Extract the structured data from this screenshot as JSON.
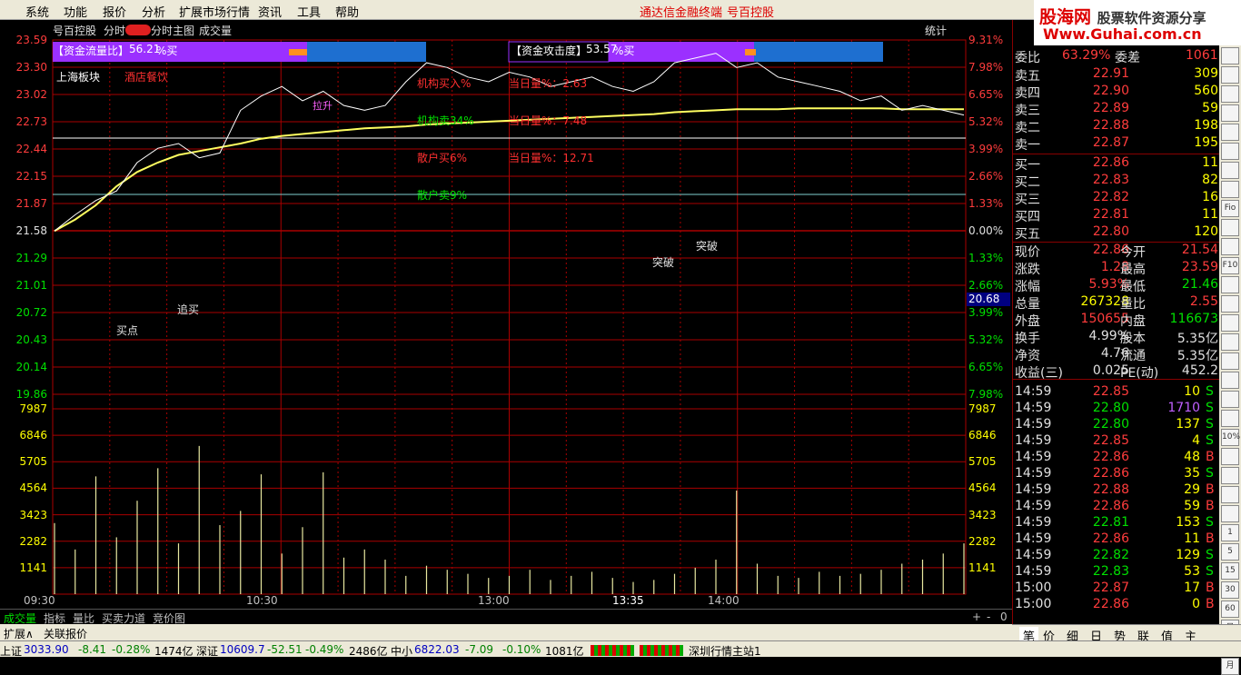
{
  "menu": [
    "系统",
    "功能",
    "报价",
    "分析",
    "扩展市场行情",
    "资讯",
    "工具",
    "帮助"
  ],
  "app_title": "通达信金融终端",
  "stock_name": "号百控股",
  "logo": {
    "line1a": "股海网",
    "line1b": "股票软件资源分享",
    "line2": "Www.Guhai.com.cn"
  },
  "chart_header": {
    "stock": "号百控股",
    "mode": "分时",
    "main": "分时主图",
    "vol": "成交量",
    "stat": "统计"
  },
  "panel1": {
    "label": "【资金流量比】",
    "value": "56.21",
    "suffix": "%买"
  },
  "panel2": {
    "label": "【资金攻击度】",
    "value": "53.57",
    "suffix": "%买"
  },
  "sector": "上海板块",
  "sector2": "酒店餐饮",
  "overlays": {
    "inst_buy": "机构买入%",
    "day_vol": "当日量%：2.63",
    "inst_sell": "机构卖34%",
    "day_vol2": "当日量%：7.48",
    "retail_buy": "散户买6%",
    "day_vol3": "当日量%：12.71",
    "retail_sell": "散户卖9%"
  },
  "annotations": {
    "buy": "买点",
    "chase": "追买",
    "break1": "突破",
    "break2": "突破",
    "lashe": "拉升"
  },
  "price_ticks": [
    "23.59",
    "23.30",
    "23.02",
    "22.73",
    "22.44",
    "22.15",
    "21.87",
    "21.58",
    "21.29",
    "21.01",
    "20.72",
    "20.43",
    "20.14",
    "19.86"
  ],
  "pct_ticks": [
    "9.31%",
    "7.98%",
    "6.65%",
    "5.32%",
    "3.99%",
    "2.66%",
    "1.33%",
    "0.00%",
    "1.33%",
    "2.66%",
    "3.99%",
    "5.32%",
    "6.65%",
    "7.98%"
  ],
  "vol_ticks": [
    "7987",
    "6846",
    "5705",
    "4564",
    "3423",
    "2282",
    "1141"
  ],
  "cursor_price": "20.68",
  "time_ticks": [
    "09:30",
    "10:30",
    "13:00",
    "13:35",
    "14:00"
  ],
  "chart_data": {
    "type": "line",
    "x_range": [
      "09:30",
      "15:00"
    ],
    "ylim": [
      19.86,
      23.59
    ],
    "prev_close": 21.58,
    "vol_ylim": [
      0,
      9128
    ],
    "price": [
      21.58,
      21.75,
      21.9,
      22.0,
      22.3,
      22.45,
      22.5,
      22.35,
      22.4,
      22.85,
      23.0,
      23.1,
      22.95,
      23.05,
      22.9,
      22.85,
      22.9,
      23.15,
      23.35,
      23.3,
      23.2,
      23.15,
      23.25,
      23.2,
      23.1,
      23.15,
      23.2,
      23.1,
      23.05,
      23.15,
      23.35,
      23.4,
      23.45,
      23.3,
      23.35,
      23.2,
      23.15,
      23.1,
      23.05,
      22.95,
      23.0,
      22.85,
      22.9,
      22.85,
      22.8
    ],
    "avg": [
      21.58,
      21.7,
      21.85,
      22.05,
      22.2,
      22.3,
      22.38,
      22.42,
      22.46,
      22.5,
      22.55,
      22.58,
      22.6,
      22.62,
      22.64,
      22.66,
      22.67,
      22.68,
      22.7,
      22.71,
      22.72,
      22.73,
      22.74,
      22.75,
      22.76,
      22.77,
      22.78,
      22.79,
      22.8,
      22.81,
      22.83,
      22.84,
      22.85,
      22.86,
      22.86,
      22.86,
      22.87,
      22.87,
      22.87,
      22.87,
      22.87,
      22.86,
      22.86,
      22.86,
      22.86
    ],
    "volume": [
      3500,
      2200,
      5800,
      2800,
      4600,
      6200,
      2500,
      7300,
      3400,
      4100,
      5900,
      2000,
      3300,
      6000,
      1800,
      2200,
      1700,
      900,
      1400,
      1200,
      1000,
      800,
      900,
      1200,
      700,
      900,
      1100,
      800,
      600,
      700,
      1000,
      1300,
      1700,
      5100,
      1500,
      900,
      800,
      1100,
      900,
      1000,
      1200,
      1500,
      1700,
      2000,
      2500
    ]
  },
  "orderbook": {
    "header": [
      "委比",
      "63.29%",
      "委差",
      "1061"
    ],
    "asks": [
      {
        "l": "卖五",
        "p": "22.91",
        "v": "309"
      },
      {
        "l": "卖四",
        "p": "22.90",
        "v": "560"
      },
      {
        "l": "卖三",
        "p": "22.89",
        "v": "59"
      },
      {
        "l": "卖二",
        "p": "22.88",
        "v": "198"
      },
      {
        "l": "卖一",
        "p": "22.87",
        "v": "195"
      }
    ],
    "bids": [
      {
        "l": "买一",
        "p": "22.86",
        "v": "11"
      },
      {
        "l": "买二",
        "p": "22.83",
        "v": "82"
      },
      {
        "l": "买三",
        "p": "22.82",
        "v": "16"
      },
      {
        "l": "买四",
        "p": "22.81",
        "v": "11"
      },
      {
        "l": "买五",
        "p": "22.80",
        "v": "120"
      }
    ]
  },
  "quote": [
    [
      "现价",
      "22.86",
      "今开",
      "21.54"
    ],
    [
      "涨跌",
      "1.28",
      "最高",
      "23.59"
    ],
    [
      "涨幅",
      "5.93%",
      "最低",
      "21.46"
    ],
    [
      "总量",
      "267328",
      "量比",
      "2.55"
    ],
    [
      "外盘",
      "150655",
      "内盘",
      "116673"
    ],
    [
      "换手",
      "4.99%",
      "股本",
      "5.35亿"
    ],
    [
      "净资",
      "4.76",
      "流通",
      "5.35亿"
    ],
    [
      "收益(三)",
      "0.025",
      "PE(动)",
      "452.2"
    ]
  ],
  "ticks": [
    [
      "14:59",
      "22.85",
      "10",
      "S"
    ],
    [
      "14:59",
      "22.80",
      "1710",
      "S"
    ],
    [
      "14:59",
      "22.80",
      "137",
      "S"
    ],
    [
      "14:59",
      "22.85",
      "4",
      "S"
    ],
    [
      "14:59",
      "22.86",
      "48",
      "B"
    ],
    [
      "14:59",
      "22.86",
      "35",
      "S"
    ],
    [
      "14:59",
      "22.88",
      "29",
      "B"
    ],
    [
      "14:59",
      "22.86",
      "59",
      "B"
    ],
    [
      "14:59",
      "22.81",
      "153",
      "S"
    ],
    [
      "14:59",
      "22.86",
      "11",
      "B"
    ],
    [
      "14:59",
      "22.82",
      "129",
      "S"
    ],
    [
      "14:59",
      "22.83",
      "53",
      "S"
    ],
    [
      "15:00",
      "22.87",
      "17",
      "B"
    ],
    [
      "15:00",
      "22.86",
      "0",
      "B"
    ]
  ],
  "bottom_tabs": [
    "成交量",
    "指标",
    "量比",
    "买卖力道",
    "竞价图"
  ],
  "sub_tabs": [
    "扩展∧",
    "关联报价"
  ],
  "right_tabs": [
    "笔",
    "价",
    "细",
    "日",
    "势",
    "联",
    "值",
    "主"
  ],
  "status": {
    "sh": "上证",
    "sh_v": "3033.90",
    "sh_c": "-8.41",
    "sh_p": "-0.28%",
    "sh_a": "1474亿",
    "sz": "深证",
    "sz_v": "10609.7",
    "sz_c": "-52.51",
    "sz_p": "-0.49%",
    "sz_a": "2486亿",
    "zx": "中小",
    "zx_v": "6822.03",
    "zx_c": "-7.09",
    "zx_p": "-0.10%",
    "zx_a": "1081亿",
    "site": "深圳行情主站1"
  },
  "rtools": [
    "",
    "",
    "",
    "",
    "",
    "",
    "",
    "",
    "Fio",
    "",
    "",
    "F10",
    "",
    "",
    "",
    "",
    "",
    "",
    "",
    "",
    "10%",
    "",
    "",
    "",
    "",
    "1",
    "5",
    "15",
    "30",
    "60",
    "日",
    "周",
    "月"
  ]
}
